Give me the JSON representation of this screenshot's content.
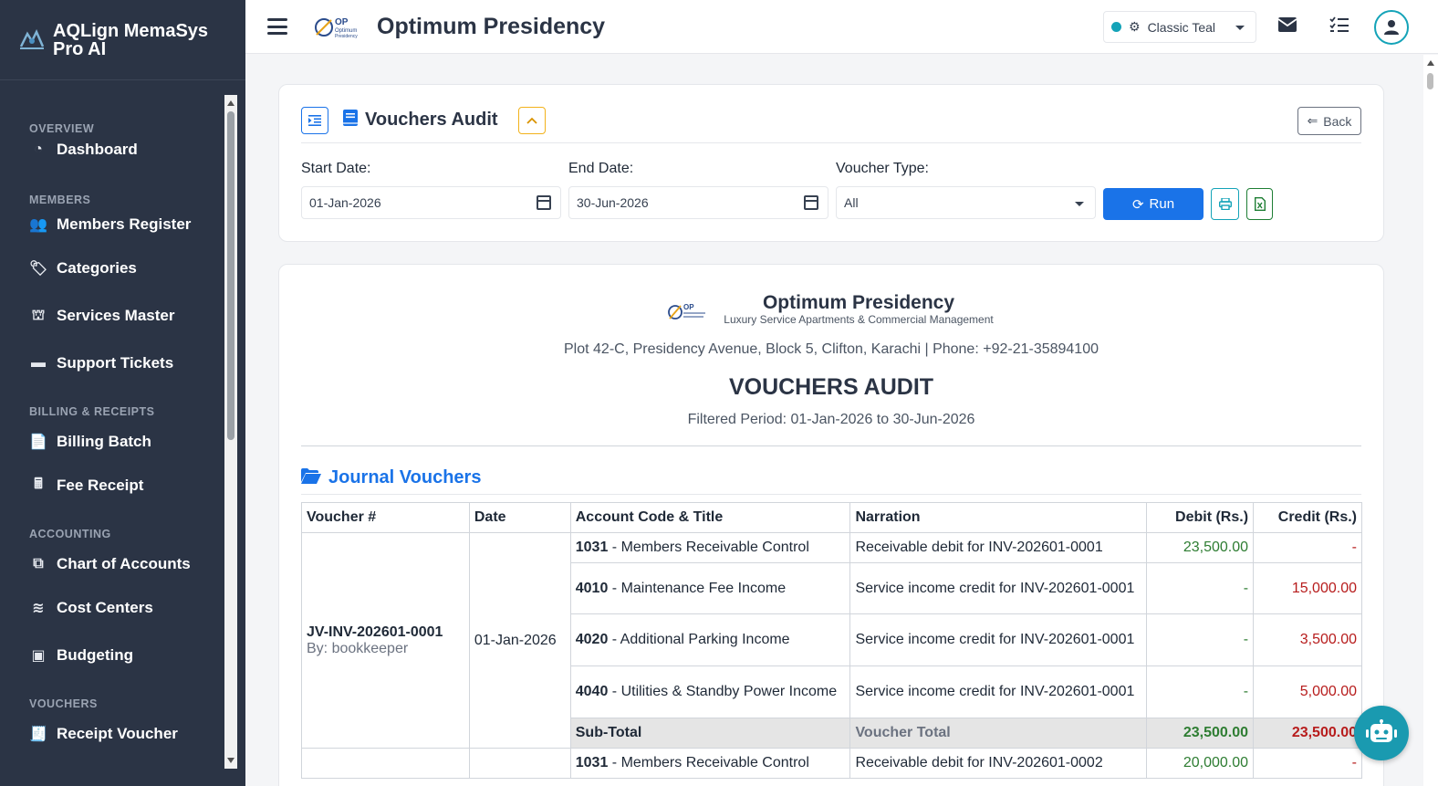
{
  "app": {
    "name": "AQLign MemaSys Pro AI"
  },
  "sidebar": {
    "sections": [
      {
        "title": "OVERVIEW",
        "items": [
          {
            "label": "Dashboard",
            "icon": "pie-chart-icon"
          }
        ]
      },
      {
        "title": "MEMBERS",
        "items": [
          {
            "label": "Members Register",
            "icon": "users-icon"
          },
          {
            "label": "Categories",
            "icon": "tags-icon"
          },
          {
            "label": "Services Master",
            "icon": "bell-service-icon"
          },
          {
            "label": "Support Tickets",
            "icon": "ticket-icon"
          }
        ]
      },
      {
        "title": "BILLING & RECEIPTS",
        "items": [
          {
            "label": "Billing Batch",
            "icon": "invoice-icon"
          },
          {
            "label": "Fee Receipt",
            "icon": "cash-register-icon"
          }
        ]
      },
      {
        "title": "ACCOUNTING",
        "items": [
          {
            "label": "Chart of Accounts",
            "icon": "sitemap-icon"
          },
          {
            "label": "Cost Centers",
            "icon": "layers-icon"
          },
          {
            "label": "Budgeting",
            "icon": "money-icon"
          }
        ]
      },
      {
        "title": "VOUCHERS",
        "items": [
          {
            "label": "Receipt Voucher",
            "icon": "receipt-icon"
          }
        ]
      }
    ]
  },
  "topbar": {
    "title": "Optimum Presidency",
    "theme": "Classic Teal",
    "theme_color": "#14a3b8"
  },
  "filter": {
    "title": "Vouchers Audit",
    "back_label": "Back",
    "start_label": "Start Date:",
    "start_value": "01-Jan-2026",
    "end_label": "End Date:",
    "end_value": "30-Jun-2026",
    "type_label": "Voucher Type:",
    "type_value": "All",
    "run_label": "Run"
  },
  "report": {
    "logo_text": "OP",
    "company": "Optimum Presidency",
    "tagline": "Luxury Service Apartments & Commercial Management",
    "address": "Plot 42-C, Presidency Avenue, Block 5, Clifton, Karachi | Phone: +92-21-35894100",
    "title": "VOUCHERS AUDIT",
    "period": "Filtered Period: 01-Jan-2026 to 30-Jun-2026",
    "section": "Journal Vouchers",
    "columns": [
      "Voucher #",
      "Date",
      "Account Code & Title",
      "Narration",
      "Debit (Rs.)",
      "Credit (Rs.)"
    ],
    "voucher1": {
      "number": "JV-INV-202601-0001",
      "by": "By: bookkeeper",
      "date": "01-Jan-2026",
      "lines": [
        {
          "code": "1031",
          "title": " - Members Receivable Control",
          "narration": "Receivable debit for INV-202601-0001",
          "debit": "23,500.00",
          "credit": "-"
        },
        {
          "code": "4010",
          "title": " - Maintenance Fee Income",
          "narration": "Service income credit for INV-202601-0001",
          "debit": "-",
          "credit": "15,000.00"
        },
        {
          "code": "4020",
          "title": " - Additional Parking Income",
          "narration": "Service income credit for INV-202601-0001",
          "debit": "-",
          "credit": "3,500.00"
        },
        {
          "code": "4040",
          "title": " - Utilities & Standby Power Income",
          "narration": "Service income credit for INV-202601-0001",
          "debit": "-",
          "credit": "5,000.00"
        }
      ],
      "subtotal_label": "Sub-Total",
      "total_label": "Voucher Total",
      "total_debit": "23,500.00",
      "total_credit": "23,500.00"
    },
    "voucher2": {
      "lines": [
        {
          "code": "1031",
          "title": " - Members Receivable Control",
          "narration": "Receivable debit for INV-202601-0002",
          "debit": "20,000.00",
          "credit": "-"
        }
      ]
    }
  }
}
